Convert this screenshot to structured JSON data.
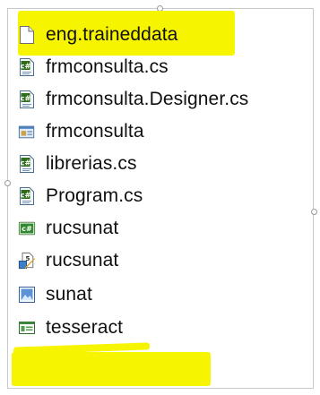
{
  "solution_explorer": {
    "items": [
      {
        "label": "eng.traineddata",
        "icon": "blank-file-icon",
        "highlighted": true
      },
      {
        "label": "frmconsulta.cs",
        "icon": "csharp-file-icon",
        "highlighted": false
      },
      {
        "label": "frmconsulta.Designer.cs",
        "icon": "csharp-file-icon",
        "highlighted": false
      },
      {
        "label": "frmconsulta",
        "icon": "form-icon",
        "highlighted": false
      },
      {
        "label": "librerias.cs",
        "icon": "csharp-file-icon",
        "highlighted": false
      },
      {
        "label": "Program.cs",
        "icon": "csharp-file-icon",
        "highlighted": false
      },
      {
        "label": "rucsunat",
        "icon": "csharp-project-icon",
        "highlighted": false
      },
      {
        "label": "rucsunat",
        "icon": "setup-package-icon",
        "highlighted": false
      },
      {
        "label": "sunat",
        "icon": "image-file-icon",
        "highlighted": true
      },
      {
        "label": "tesseract",
        "icon": "executable-icon",
        "highlighted": true
      }
    ]
  },
  "colors": {
    "highlight": "#f7f400",
    "text": "#101010",
    "border": "#c9c9c9"
  }
}
